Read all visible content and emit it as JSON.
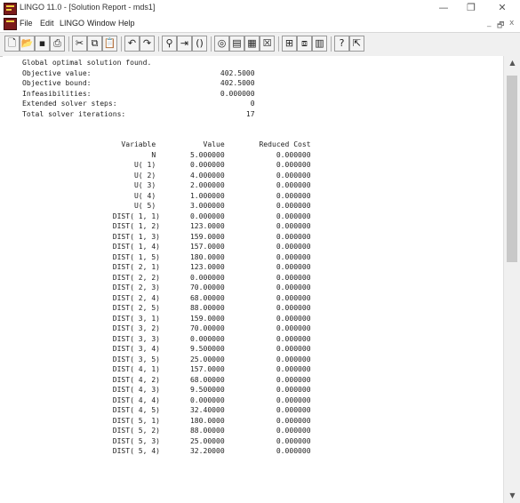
{
  "window": {
    "title": "LINGO 11.0 - [Solution Report - mds1]",
    "minimize": "—",
    "restore": "❐",
    "close": "✕"
  },
  "menubar": {
    "items": [
      "File",
      "Edit",
      "LINGO",
      "Window",
      "Help"
    ],
    "mdi_minimize": "_",
    "mdi_restore": "🗗",
    "mdi_close": "x"
  },
  "toolbar": {
    "buttons": [
      {
        "icon": "new-icon",
        "glyph": "🗋"
      },
      {
        "icon": "open-icon",
        "glyph": "📂"
      },
      {
        "icon": "save-icon",
        "glyph": "▪"
      },
      {
        "icon": "print-icon",
        "glyph": "⎙"
      },
      {
        "icon": "cut-icon",
        "glyph": "✂"
      },
      {
        "icon": "copy-icon",
        "glyph": "⧉"
      },
      {
        "icon": "paste-icon",
        "glyph": "📋"
      },
      {
        "icon": "undo-icon",
        "glyph": "↶"
      },
      {
        "icon": "redo-icon",
        "glyph": "↷"
      },
      {
        "icon": "find-icon",
        "glyph": "⚲"
      },
      {
        "icon": "goto-line-icon",
        "glyph": "⇥"
      },
      {
        "icon": "match-paren-icon",
        "glyph": "()"
      },
      {
        "icon": "solve-icon",
        "glyph": "◎"
      },
      {
        "icon": "solution-icon",
        "glyph": "▤"
      },
      {
        "icon": "matrix-picture-icon",
        "glyph": "▦"
      },
      {
        "icon": "close-all-icon",
        "glyph": "☒"
      },
      {
        "icon": "tile-icon",
        "glyph": "⊞"
      },
      {
        "icon": "send-to-back-icon",
        "glyph": "⧈"
      },
      {
        "icon": "options-icon",
        "glyph": "▥"
      },
      {
        "icon": "help-topics-icon",
        "glyph": "?"
      },
      {
        "icon": "context-help-icon",
        "glyph": "⇱"
      }
    ]
  },
  "report": {
    "lines": [
      "Global optimal solution found.",
      "Objective value:                              402.5000",
      "Objective bound:                              402.5000",
      "Infeasibilities:                              0.000000",
      "Extended solver steps:                               0",
      "Total solver iterations:                            17",
      "",
      "",
      "                       Variable           Value        Reduced Cost",
      "                              N        5.000000            0.000000",
      "                          U( 1)        0.000000            0.000000",
      "                          U( 2)        4.000000            0.000000",
      "                          U( 3)        2.000000            0.000000",
      "                          U( 4)        1.000000            0.000000",
      "                          U( 5)        3.000000            0.000000",
      "                     DIST( 1, 1)       0.000000            0.000000",
      "                     DIST( 1, 2)       123.0000            0.000000",
      "                     DIST( 1, 3)       159.0000            0.000000",
      "                     DIST( 1, 4)       157.0000            0.000000",
      "                     DIST( 1, 5)       180.0000            0.000000",
      "                     DIST( 2, 1)       123.0000            0.000000",
      "                     DIST( 2, 2)       0.000000            0.000000",
      "                     DIST( 2, 3)       70.00000            0.000000",
      "                     DIST( 2, 4)       68.00000            0.000000",
      "                     DIST( 2, 5)       88.00000            0.000000",
      "                     DIST( 3, 1)       159.0000            0.000000",
      "                     DIST( 3, 2)       70.00000            0.000000",
      "                     DIST( 3, 3)       0.000000            0.000000",
      "                     DIST( 3, 4)       9.500000            0.000000",
      "                     DIST( 3, 5)       25.00000            0.000000",
      "                     DIST( 4, 1)       157.0000            0.000000",
      "                     DIST( 4, 2)       68.00000            0.000000",
      "                     DIST( 4, 3)       9.500000            0.000000",
      "                     DIST( 4, 4)       0.000000            0.000000",
      "                     DIST( 4, 5)       32.40000            0.000000",
      "                     DIST( 5, 1)       180.0000            0.000000",
      "                     DIST( 5, 2)       88.00000            0.000000",
      "                     DIST( 5, 3)       25.00000            0.000000",
      "                     DIST( 5, 4)       32.20000            0.000000"
    ]
  },
  "scrollbar": {
    "up_arrow": "▲",
    "down_arrow": "▼"
  }
}
